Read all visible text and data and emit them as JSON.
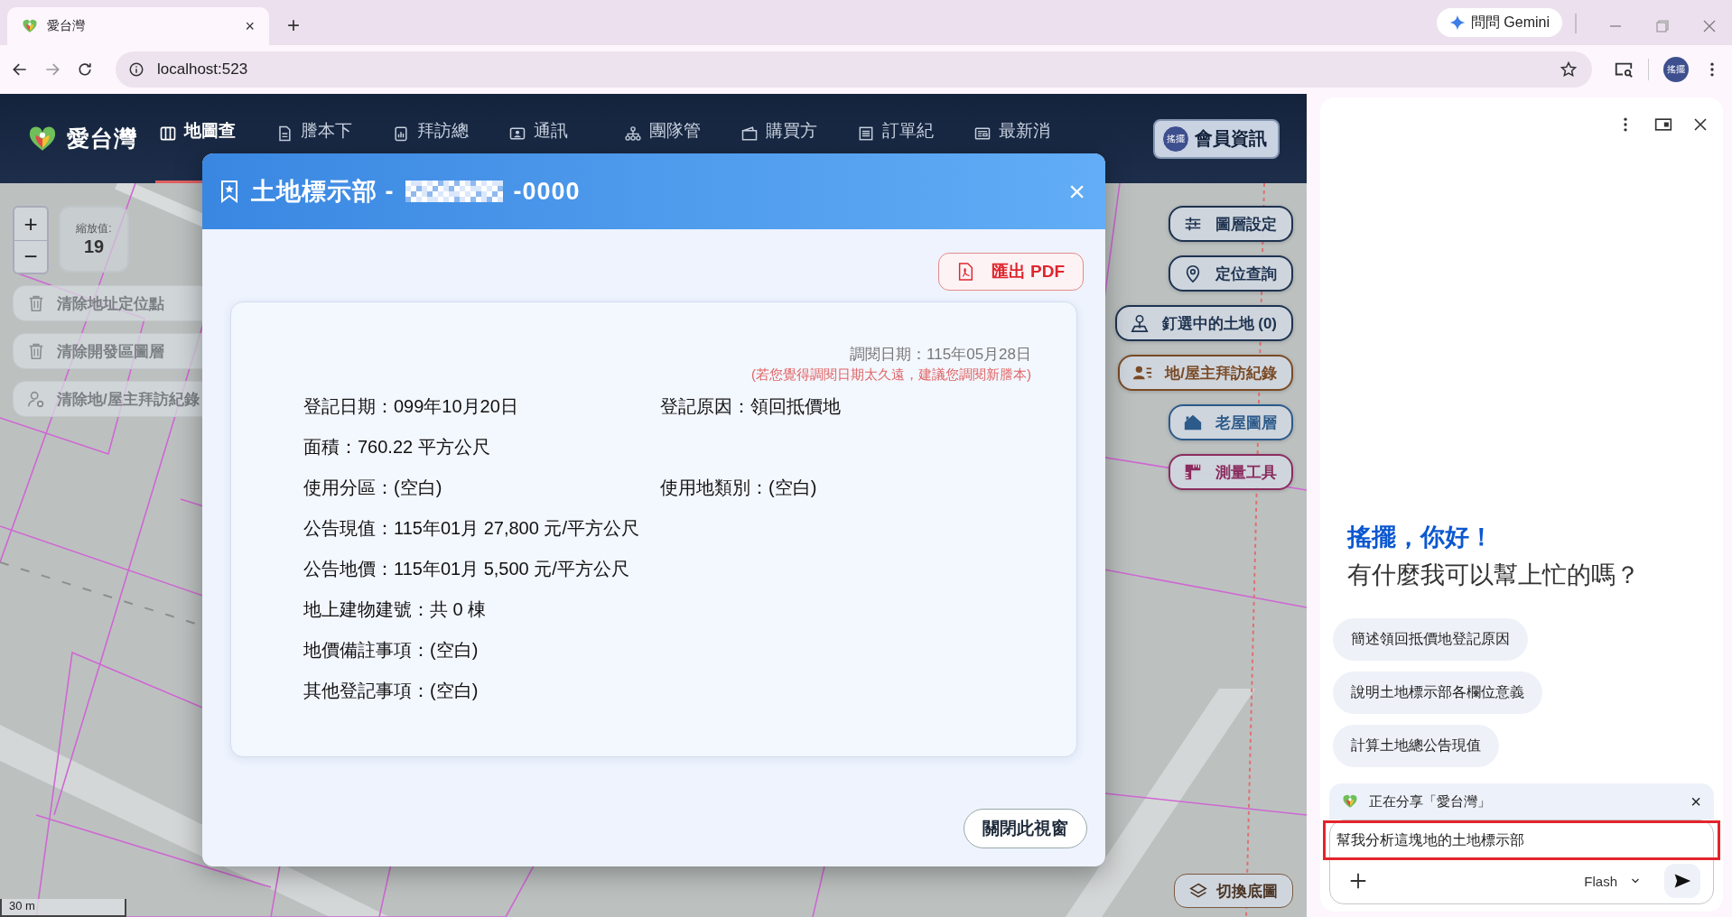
{
  "browser": {
    "tab_title": "愛台灣",
    "close_tab": "×",
    "new_tab": "+",
    "gemini_button": "問問 Gemini",
    "url": "localhost:523",
    "avatar": "搖擺"
  },
  "app": {
    "brand": "愛台灣",
    "nav": [
      {
        "label": "地圖查",
        "kind": "map",
        "selected": true
      },
      {
        "label": "謄本下",
        "kind": "doc",
        "selected": false
      },
      {
        "label": "拜訪總",
        "kind": "chart",
        "selected": false
      },
      {
        "label": "通訊",
        "kind": "contact",
        "selected": false
      },
      {
        "label": "團隊管",
        "kind": "org",
        "selected": false
      },
      {
        "label": "購買方",
        "kind": "wallet",
        "selected": false
      },
      {
        "label": "訂單紀",
        "kind": "list",
        "selected": false
      },
      {
        "label": "最新消",
        "kind": "news",
        "selected": false
      }
    ],
    "member": {
      "avatar": "搖擺",
      "label": "會員資訊"
    }
  },
  "map": {
    "zoom_in": "+",
    "zoom_out": "−",
    "zoom_label": "縮放值:",
    "zoom_value": "19",
    "left_actions": [
      {
        "label": "清除地址定位點",
        "kind": "trash"
      },
      {
        "label": "清除開發區圖層",
        "kind": "trash"
      },
      {
        "label": "清除地/屋主拜訪紀錄",
        "kind": "person-x"
      }
    ],
    "right_actions": [
      {
        "label": "圖層設定",
        "kind": "sliders",
        "color": "#1e3350"
      },
      {
        "label": "定位查詢",
        "kind": "pin",
        "color": "#1e3350"
      },
      {
        "label": "釘選中的土地 (0)",
        "kind": "person-pin",
        "color": "#1e3350"
      },
      {
        "label": "地/屋主拜訪紀錄",
        "kind": "contacts",
        "color": "#7a4a25"
      },
      {
        "label": "老屋圖層",
        "kind": "house",
        "color": "#2c5a8a"
      },
      {
        "label": "測量工具",
        "kind": "ruler",
        "color": "#8a2c5e"
      }
    ],
    "basemap_button": "切換底圖",
    "scale": "30 m"
  },
  "modal": {
    "close": "×",
    "title": "土地標示部 -",
    "title_suffix": "-0000",
    "export_button": "匯出 PDF",
    "query_date": "調閱日期：115年05月28日",
    "note": "(若您覺得調閱日期太久遠，建議您調閱新謄本)",
    "fields": [
      {
        "cells": [
          "登記日期：099年10月20日",
          "登記原因：領回抵價地"
        ]
      },
      {
        "cells": [
          "面積：760.22 平方公尺"
        ]
      },
      {
        "cells": [
          "使用分區：(空白)",
          "使用地類別：(空白)"
        ]
      },
      {
        "cells": [
          "公告現值：115年01月 27,800 元/平方公尺"
        ]
      },
      {
        "cells": [
          "公告地價：115年01月 5,500 元/平方公尺"
        ]
      },
      {
        "cells": [
          "地上建物建號：共 0 棟"
        ]
      },
      {
        "cells": [
          "地價備註事項：(空白)"
        ]
      },
      {
        "cells": [
          "其他登記事項：(空白)"
        ]
      }
    ],
    "close_button": "關閉此視窗"
  },
  "gemini": {
    "greeting_name": "搖擺，你好！",
    "greeting": "有什麼我可以幫上忙的嗎？",
    "suggestions": [
      "簡述領回抵價地登記原因",
      "說明土地標示部各欄位意義",
      "計算土地總公告現值"
    ],
    "sharing": "正在分享「愛台灣」",
    "stop_sharing": "×",
    "input": {
      "value": "幫我分析這塊地的土地標示部",
      "highlighted": true
    },
    "model": "Flash"
  }
}
